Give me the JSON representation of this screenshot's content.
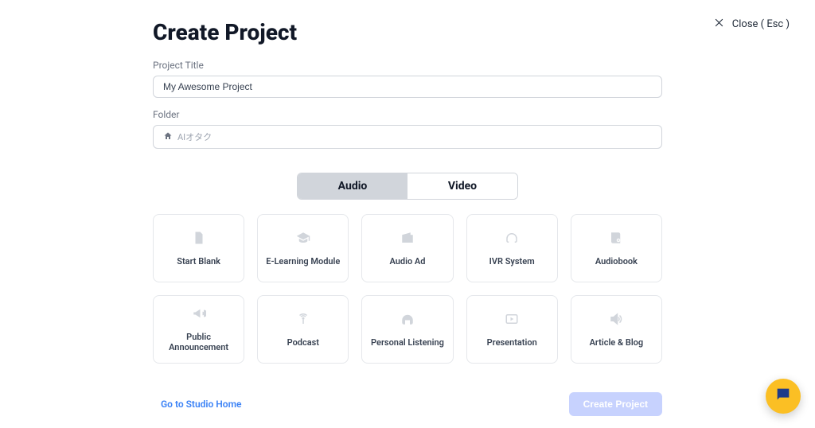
{
  "header": {
    "title": "Create Project",
    "close_label": "Close ( Esc )"
  },
  "fields": {
    "title_label": "Project Title",
    "title_value": "My Awesome Project",
    "folder_label": "Folder",
    "folder_value": "AIオタク"
  },
  "tabs": {
    "audio": "Audio",
    "video": "Video",
    "active": "audio"
  },
  "cards": [
    {
      "icon": "file-icon",
      "label": "Start Blank"
    },
    {
      "icon": "graduation-icon",
      "label": "E-Learning Module"
    },
    {
      "icon": "radio-icon",
      "label": "Audio Ad"
    },
    {
      "icon": "headset-icon",
      "label": "IVR System"
    },
    {
      "icon": "book-audio-icon",
      "label": "Audiobook"
    },
    {
      "icon": "megaphone-icon",
      "label": "Public Announcement"
    },
    {
      "icon": "broadcast-icon",
      "label": "Podcast"
    },
    {
      "icon": "headphones-icon",
      "label": "Personal Listening"
    },
    {
      "icon": "play-square-icon",
      "label": "Presentation"
    },
    {
      "icon": "volume-icon",
      "label": "Article & Blog"
    }
  ],
  "footer": {
    "home_link": "Go to Studio Home",
    "create_button": "Create Project"
  }
}
